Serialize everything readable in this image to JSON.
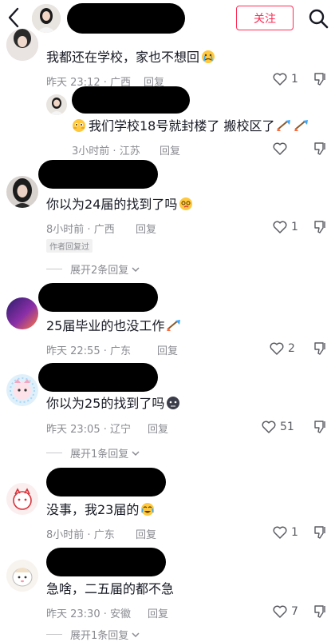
{
  "header": {
    "follow_label": "关注"
  },
  "icons": {
    "back": "chevron-left-icon",
    "search": "search-icon",
    "like": "heart-icon",
    "dislike": "thumbs-down-icon"
  },
  "comments": [
    {
      "text": "我都还在学校，家也不想回",
      "time": "昨天 23:12",
      "loc": "广西",
      "reply": "回复",
      "likes": "1"
    },
    {
      "text": "我们学校18号就封楼了 搬校区了",
      "time": "3小时前",
      "loc": "江苏",
      "reply": "回复",
      "likes": ""
    },
    {
      "text": "你以为24届的找到了吗",
      "time": "8小时前",
      "loc": "广西",
      "reply": "回复",
      "likes": "1",
      "badge": "作者回复过",
      "expand": "展开2条回复"
    },
    {
      "text": "25届毕业的也没工作",
      "time": "昨天 22:55",
      "loc": "广东",
      "reply": "回复",
      "likes": "2"
    },
    {
      "text": "你以为25的找到了吗",
      "time": "昨天 23:05",
      "loc": "辽宁",
      "reply": "回复",
      "likes": "51",
      "expand": "展开1条回复"
    },
    {
      "text": "没事，我23届的",
      "time": "8小时前",
      "loc": "广东",
      "reply": "回复",
      "likes": "1"
    },
    {
      "text": "急啥，二五届的都不急",
      "time": "昨天 23:30",
      "loc": "安徽",
      "reply": "回复",
      "likes": "7",
      "expand": "展开1条回复"
    }
  ]
}
